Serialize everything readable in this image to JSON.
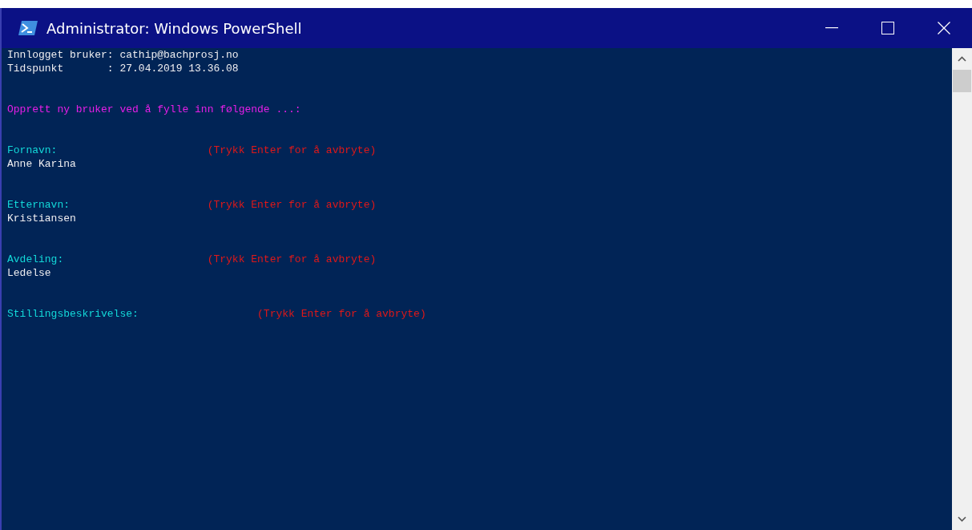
{
  "window": {
    "title": "Administrator: Windows PowerShell"
  },
  "console": {
    "info_lines": [
      "Innlogget bruker: cathip@bachprosj.no",
      "Tidspunkt       : 27.04.2019 13.36.08"
    ],
    "heading": "Opprett ny bruker ved å fylle inn følgende ...:",
    "prompts": [
      {
        "label": "Fornavn:",
        "hint": "(Trykk Enter for å avbryte)",
        "value": "Anne Karina"
      },
      {
        "label": "Etternavn:",
        "hint": "(Trykk Enter for å avbryte)",
        "value": "Kristiansen"
      },
      {
        "label": "Avdeling:",
        "hint": "(Trykk Enter for å avbryte)",
        "value": "Ledelse"
      },
      {
        "label": "Stillingsbeskrivelse:",
        "hint": "(Trykk Enter for å avbryte)"
      }
    ]
  }
}
